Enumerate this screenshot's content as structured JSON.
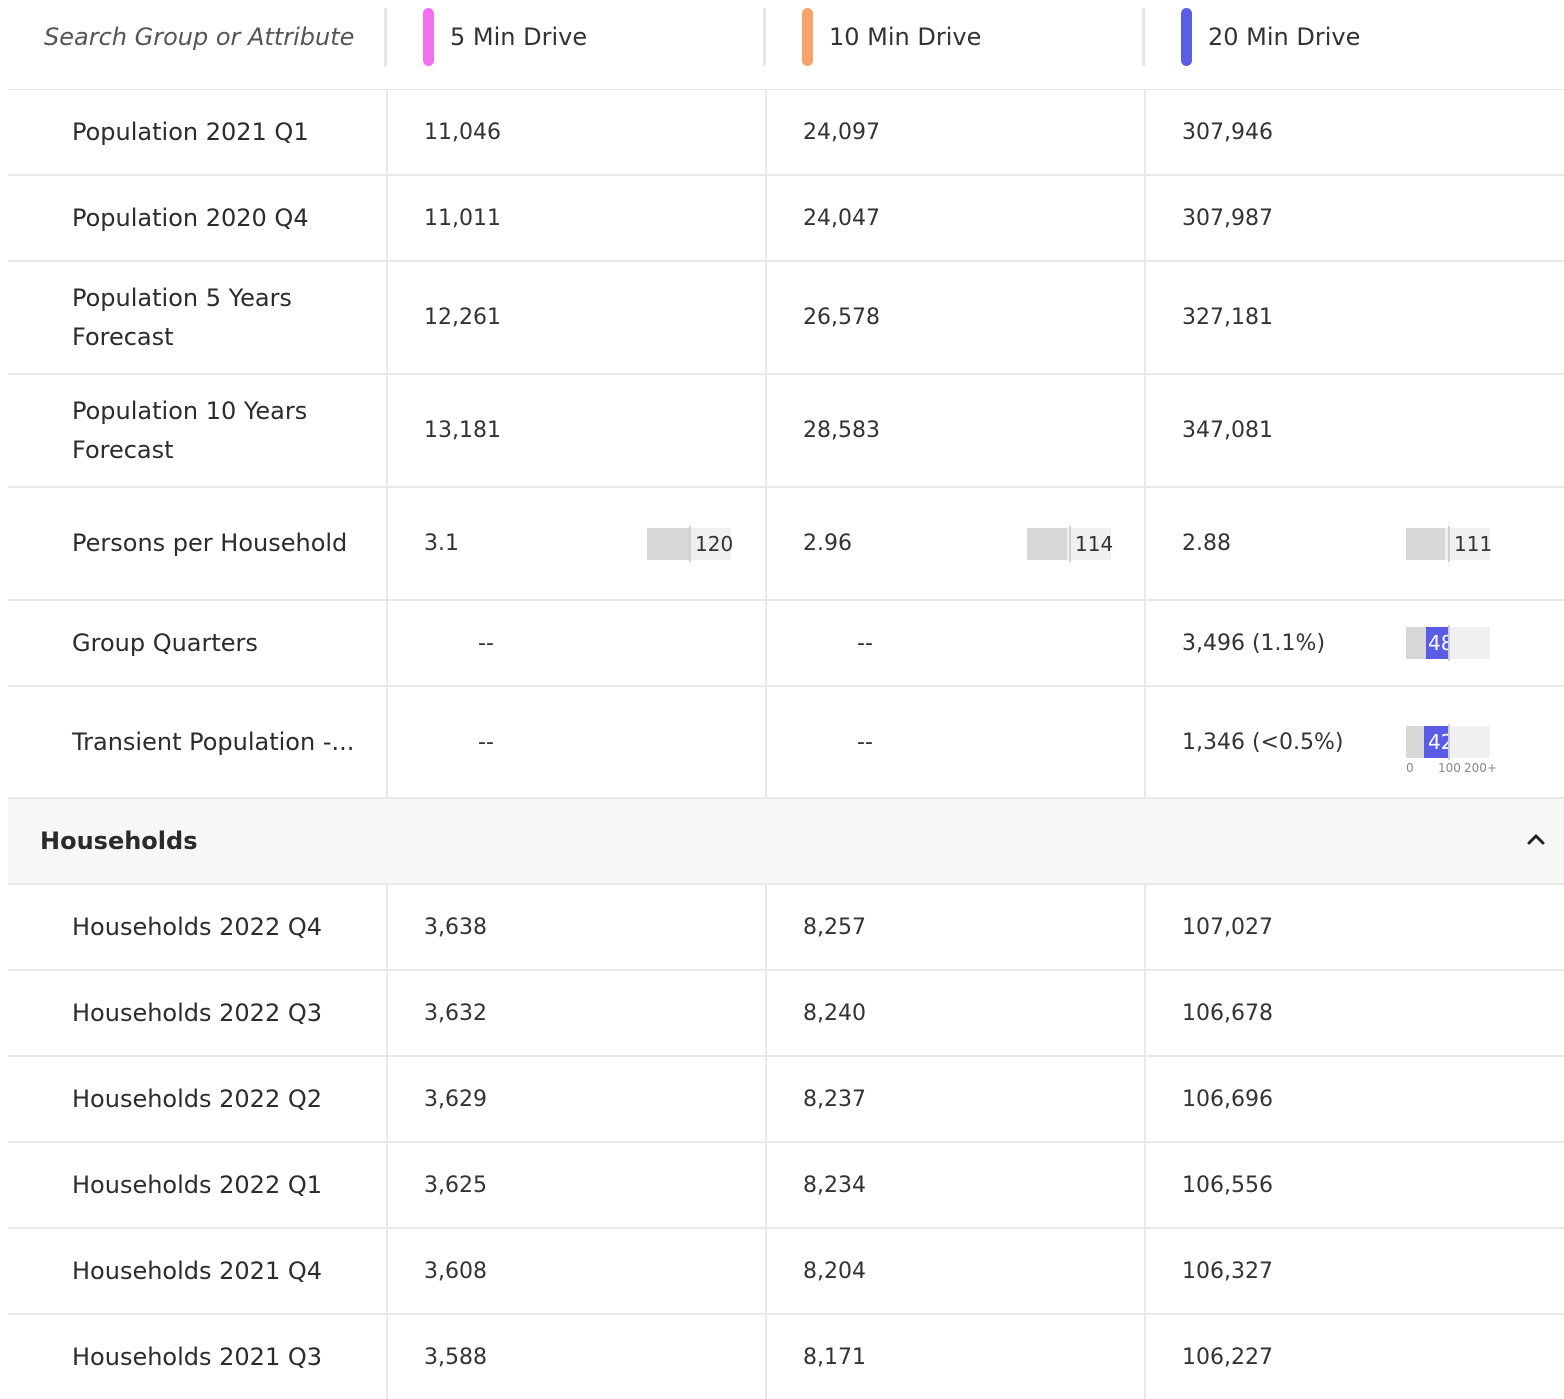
{
  "search": {
    "placeholder": "Search Group or Attribute"
  },
  "columns": [
    {
      "label": "5 Min Drive",
      "color": "#f56ef0"
    },
    {
      "label": "10 Min Drive",
      "color": "#f6a46b"
    },
    {
      "label": "20 Min Drive",
      "color": "#5b5de4"
    }
  ],
  "population_rows": [
    {
      "name": "Population 2021 Q1",
      "values": [
        "11,046",
        "24,097",
        "307,946"
      ]
    },
    {
      "name": "Population 2020 Q4",
      "values": [
        "11,011",
        "24,047",
        "307,987"
      ]
    },
    {
      "name": "Population 5 Years Forecast",
      "values": [
        "12,261",
        "26,578",
        "327,181"
      ]
    },
    {
      "name": "Population 10 Years Forecast",
      "values": [
        "13,181",
        "28,583",
        "347,081"
      ]
    },
    {
      "name": "Persons per Household",
      "values": [
        "3.1",
        "2.96",
        "2.88"
      ],
      "index": [
        "120",
        "114",
        "111"
      ],
      "index_fraction": [
        0.6,
        0.57,
        0.555
      ]
    },
    {
      "name": "Group Quarters",
      "values": [
        "--",
        "--",
        "3,496 (1.1%)"
      ],
      "index": [
        "",
        "",
        "48"
      ],
      "index_fraction": [
        0,
        0,
        0.24
      ]
    },
    {
      "name": "Transient Population -...",
      "values": [
        "--",
        "--",
        "1,346 (<0.5%)"
      ],
      "index": [
        "",
        "",
        "42"
      ],
      "index_fraction": [
        0,
        0,
        0.21
      ]
    }
  ],
  "scale": {
    "min": "0",
    "mid": "100",
    "max": "200+"
  },
  "households": {
    "title": "Households",
    "rows": [
      {
        "name": "Households 2022 Q4",
        "values": [
          "3,638",
          "8,257",
          "107,027"
        ]
      },
      {
        "name": "Households 2022 Q3",
        "values": [
          "3,632",
          "8,240",
          "106,678"
        ]
      },
      {
        "name": "Households 2022 Q2",
        "values": [
          "3,629",
          "8,237",
          "106,696"
        ]
      },
      {
        "name": "Households 2022 Q1",
        "values": [
          "3,625",
          "8,234",
          "106,556"
        ]
      },
      {
        "name": "Households 2021 Q4",
        "values": [
          "3,608",
          "8,204",
          "106,327"
        ]
      },
      {
        "name": "Households 2021 Q3",
        "values": [
          "3,588",
          "8,171",
          "106,227"
        ]
      }
    ]
  }
}
